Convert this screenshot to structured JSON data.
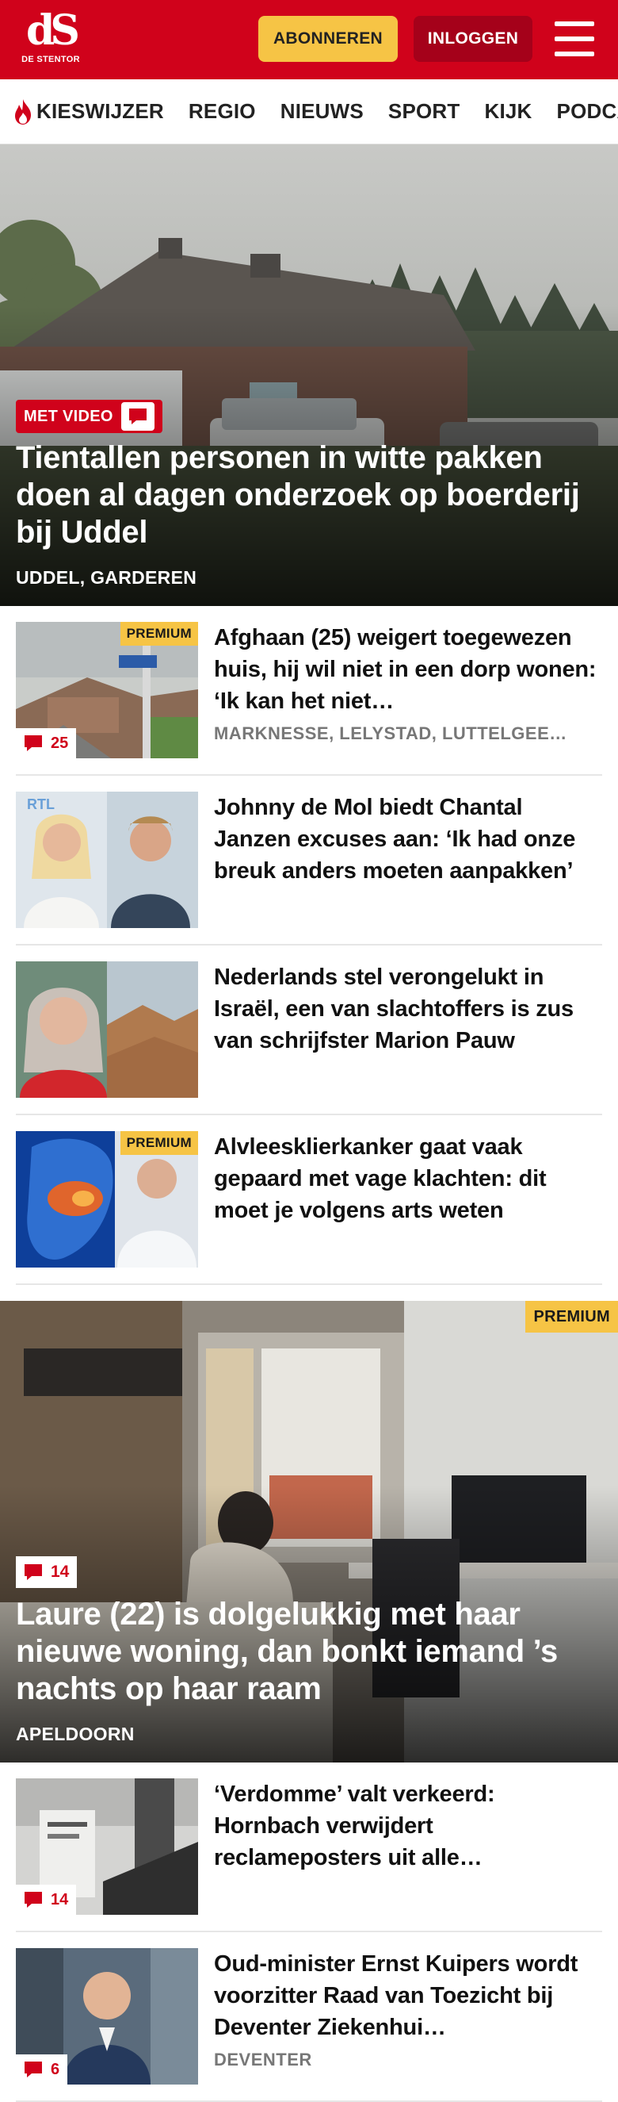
{
  "header": {
    "logo_text": "dS",
    "logo_subtitle": "DE STENTOR",
    "subscribe_label": "ABONNEREN",
    "login_label": "INLOGGEN",
    "menu_icon": "hamburger-menu-icon",
    "brand_color": "#d0021b",
    "subscribe_color": "#f6c445"
  },
  "nav": {
    "items": [
      {
        "label": "KIESWIJZER",
        "icon": "flame-icon"
      },
      {
        "label": "REGIO"
      },
      {
        "label": "NIEUWS"
      },
      {
        "label": "SPORT"
      },
      {
        "label": "KIJK"
      },
      {
        "label": "PODCAS"
      }
    ]
  },
  "hero": {
    "badge": "MET VIDEO",
    "title": "Tientallen personen in witte pakken doen al dagen onderzoek op boerderij bij Uddel",
    "location": "UDDEL, GARDEREN"
  },
  "articles_a": [
    {
      "title": "Afghaan (25) weigert toegewezen huis, hij wil niet in een dorp wonen: ‘Ik kan het niet…",
      "location": "MARKNESSE, LELYSTAD, LUTTELGEE…",
      "premium": "PREMIUM",
      "comments": "25"
    },
    {
      "title": "Johnny de Mol biedt Chantal Janzen excuses aan: ‘Ik had onze breuk anders moeten aanpakken’"
    },
    {
      "title": "Nederlands stel verongelukt in Israël, een van slachtoffers is zus van schrijfster Marion Pauw"
    },
    {
      "title": "Alvleesklierkanker gaat vaak gepaard met vage klachten: dit moet je volgens arts weten",
      "premium": "PREMIUM"
    }
  ],
  "feature": {
    "premium": "PREMIUM",
    "comments": "14",
    "title": "Laure (22) is dolgelukkig met haar nieuwe woning, dan bonkt iemand ’s nachts op haar raam",
    "location": "APELDOORN"
  },
  "articles_b": [
    {
      "title": "‘Verdomme’ valt verkeerd: Hornbach verwijdert reclameposters uit alle…",
      "comments": "14"
    },
    {
      "title": "Oud-minister Ernst Kuipers wordt voorzitter Raad van Toezicht bij Deventer Ziekenhui…",
      "location": "DEVENTER",
      "comments": "6"
    }
  ]
}
